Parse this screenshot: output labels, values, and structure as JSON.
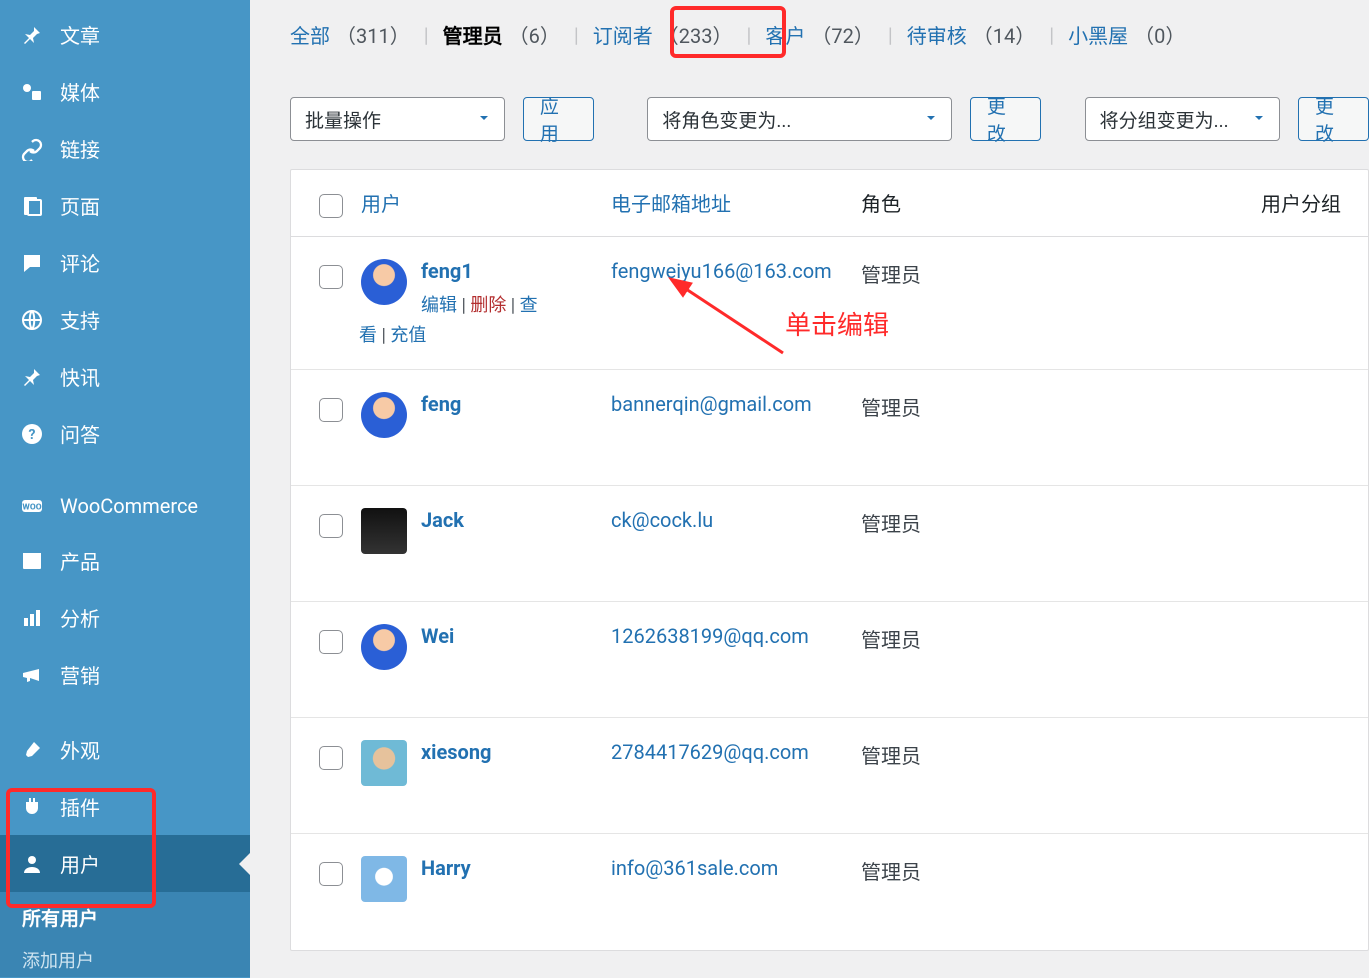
{
  "sidebar": {
    "items": [
      {
        "icon": "pin",
        "label": "文章"
      },
      {
        "icon": "media",
        "label": "媒体"
      },
      {
        "icon": "link",
        "label": "链接"
      },
      {
        "icon": "page",
        "label": "页面"
      },
      {
        "icon": "comment",
        "label": "评论"
      },
      {
        "icon": "support",
        "label": "支持"
      },
      {
        "icon": "pin",
        "label": "快讯"
      },
      {
        "icon": "help",
        "label": "问答"
      },
      {
        "icon": "woo",
        "label": "WooCommerce"
      },
      {
        "icon": "product",
        "label": "产品"
      },
      {
        "icon": "chart",
        "label": "分析"
      },
      {
        "icon": "mega",
        "label": "营销"
      },
      {
        "icon": "brush",
        "label": "外观"
      },
      {
        "icon": "plugin",
        "label": "插件"
      },
      {
        "icon": "user",
        "label": "用户"
      }
    ],
    "sub": {
      "allusers": "所有用户",
      "adduser": "添加用户"
    }
  },
  "filters": [
    {
      "label": "全部",
      "count": "（311）",
      "active": false
    },
    {
      "label": "管理员",
      "count": "（6）",
      "active": true
    },
    {
      "label": "订阅者",
      "count": "（233）",
      "active": false
    },
    {
      "label": "客户",
      "count": "（72）",
      "active": false
    },
    {
      "label": "待审核",
      "count": "（14）",
      "active": false
    },
    {
      "label": "小黑屋",
      "count": "（0）",
      "active": false
    }
  ],
  "toolbar": {
    "bulkaction": "批量操作",
    "apply": "应用",
    "changerole": "将角色变更为...",
    "change": "更改",
    "changegroup": "将分组变更为...",
    "change2": "更改"
  },
  "table": {
    "head": {
      "user": "用户",
      "email": "电子邮箱地址",
      "role": "角色",
      "group": "用户分组"
    },
    "rows": [
      {
        "avatar": "av-bg1",
        "shape": "round",
        "name": "feng1",
        "email": "fengweiyu166@163.com",
        "role": "管理员",
        "showactions": true
      },
      {
        "avatar": "av-bg1",
        "shape": "round",
        "name": "feng",
        "email": "bannerqin@gmail.com",
        "role": "管理员",
        "showactions": false
      },
      {
        "avatar": "av-bg2",
        "shape": "sq",
        "name": "Jack",
        "email": "ck@cock.lu",
        "role": "管理员",
        "showactions": false
      },
      {
        "avatar": "av-bg1",
        "shape": "round",
        "name": "Wei",
        "email": "1262638199@qq.com",
        "role": "管理员",
        "showactions": false
      },
      {
        "avatar": "av-bg3",
        "shape": "sq",
        "name": "xiesong",
        "email": "2784417629@qq.com",
        "role": "管理员",
        "showactions": false
      },
      {
        "avatar": "av-bg5",
        "shape": "sq",
        "name": "Harry",
        "email": "info@361sale.com",
        "role": "管理员",
        "showactions": false
      }
    ],
    "actions": {
      "edit": "编辑",
      "delete": "删除",
      "view": "查看",
      "recharge": "充值"
    }
  },
  "annotation": {
    "text": "单击编辑"
  }
}
